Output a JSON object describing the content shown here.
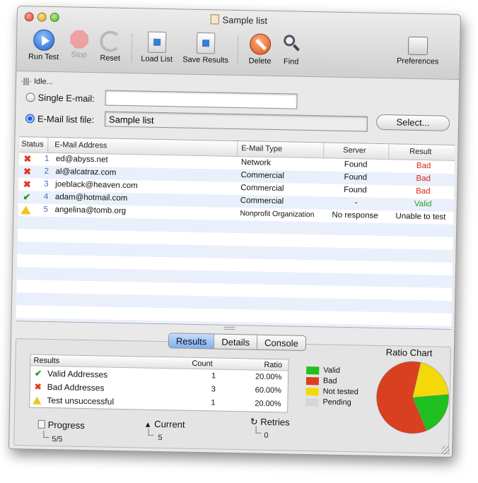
{
  "window": {
    "title": "Sample list"
  },
  "toolbar": {
    "run_test": "Run Test",
    "stop": "Stop",
    "reset": "Reset",
    "load_list": "Load List",
    "save_results": "Save Results",
    "delete": "Delete",
    "find": "Find",
    "preferences": "Preferences"
  },
  "status": {
    "text": "Idle..."
  },
  "form": {
    "single_label": "Single E-mail:",
    "single_value": "",
    "list_label": "E-Mail list file:",
    "list_value": "Sample list",
    "select_button": "Select..."
  },
  "table": {
    "columns": [
      "Status",
      "E-Mail Address",
      "E-Mail Type",
      "Server",
      "Result"
    ],
    "rows": [
      {
        "status": "bad",
        "num": "1",
        "email": "ed@abyss.net",
        "type": "Network",
        "server": "Found",
        "result": "Bad"
      },
      {
        "status": "bad",
        "num": "2",
        "email": "al@alcatraz.com",
        "type": "Commercial",
        "server": "Found",
        "result": "Bad"
      },
      {
        "status": "bad",
        "num": "3",
        "email": "joeblack@heaven.com",
        "type": "Commercial",
        "server": "Found",
        "result": "Bad"
      },
      {
        "status": "valid",
        "num": "4",
        "email": "adam@hotmail.com",
        "type": "Commercial",
        "server": "-",
        "result": "Valid"
      },
      {
        "status": "warning",
        "num": "5",
        "email": "angelina@tomb.org",
        "type": "Nonprofit Organization",
        "server": "No response",
        "result": "Unable to test"
      }
    ]
  },
  "tabs": [
    "Results",
    "Details",
    "Console"
  ],
  "results": {
    "columns": [
      "Results",
      "Count",
      "Ratio"
    ],
    "rows": [
      {
        "label": "Valid Addresses",
        "count": "1",
        "ratio": "20.00%"
      },
      {
        "label": "Bad Addresses",
        "count": "3",
        "ratio": "60.00%"
      },
      {
        "label": "Test unsuccessful",
        "count": "1",
        "ratio": "20.00%"
      }
    ]
  },
  "legend": [
    {
      "label": "Valid",
      "color": "#1fc01f"
    },
    {
      "label": "Bad",
      "color": "#d9401f"
    },
    {
      "label": "Not tested",
      "color": "#f5d80a"
    },
    {
      "label": "Pending",
      "color": "#d6d6d6"
    }
  ],
  "chart_data": {
    "type": "pie",
    "title": "Ratio Chart",
    "categories": [
      "Valid",
      "Bad",
      "Not tested",
      "Pending"
    ],
    "values": [
      20,
      60,
      20,
      0
    ],
    "colors": [
      "#1fc01f",
      "#d9401f",
      "#f5d80a",
      "#d6d6d6"
    ]
  },
  "progress": {
    "label": "Progress",
    "value": "5/5"
  },
  "current": {
    "label": "Current",
    "value": "5"
  },
  "retries": {
    "label": "Retries",
    "value": "0"
  }
}
